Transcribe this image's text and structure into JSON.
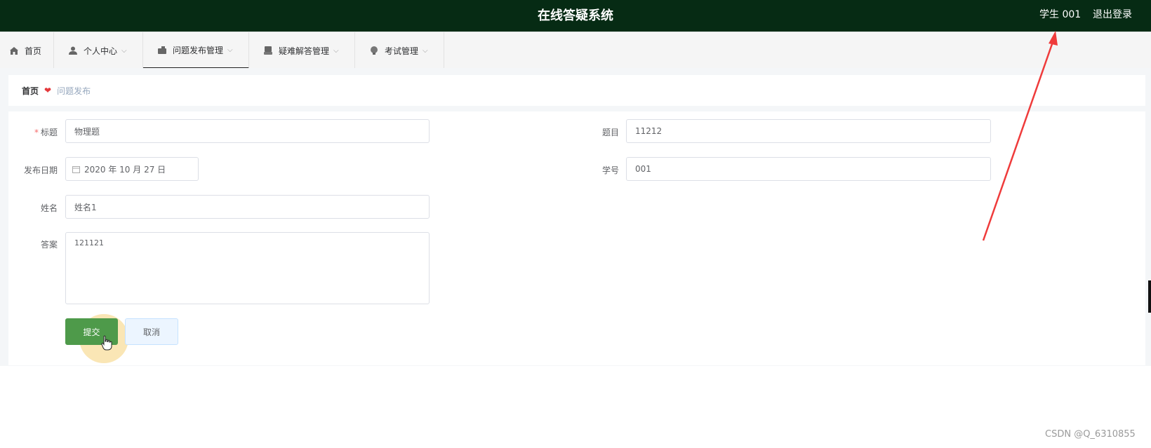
{
  "header": {
    "title": "在线答疑系统",
    "user": "学生 001",
    "logout": "退出登录"
  },
  "nav": {
    "items": [
      {
        "label": "首页",
        "icon": "home-icon"
      },
      {
        "label": "个人中心",
        "icon": "user-icon"
      },
      {
        "label": "问题发布管理",
        "icon": "folder-icon"
      },
      {
        "label": "疑难解答管理",
        "icon": "archive-icon"
      },
      {
        "label": "考试管理",
        "icon": "bulb-icon"
      }
    ],
    "active": "问题发布管理"
  },
  "breadcrumb": {
    "home": "首页",
    "current": "问题发布"
  },
  "form": {
    "title_label": "标题",
    "title_value": "物理题",
    "topic_label": "题目",
    "topic_value": "11212",
    "date_label": "发布日期",
    "date_value": "2020 年 10 月 27 日",
    "student_id_label": "学号",
    "student_id_value": "001",
    "name_label": "姓名",
    "name_value": "姓名1",
    "answer_label": "答案",
    "answer_value": "121121",
    "submit_label": "提交",
    "cancel_label": "取消"
  },
  "watermark": "CSDN @Q_6310855",
  "colors": {
    "header_bg": "#062b14",
    "submit": "#4e9a4a",
    "arrow": "#ef3b3b"
  }
}
